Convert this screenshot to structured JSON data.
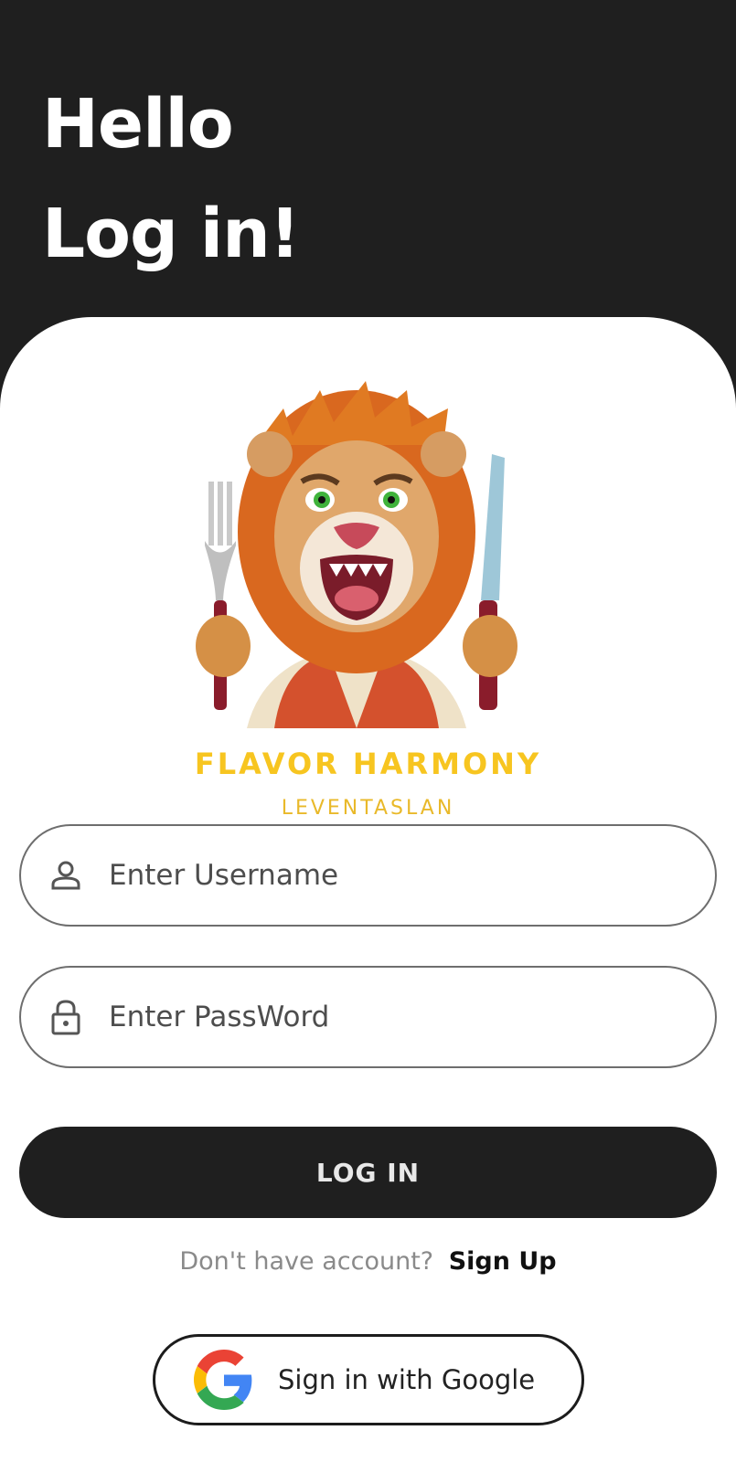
{
  "header": {
    "line1": "Hello",
    "line2": "Log in!"
  },
  "brand": {
    "title": "FLAVOR HARMONY",
    "subtitle": "LEVENTASLAN",
    "logo_icon": "lion-chef-mascot"
  },
  "form": {
    "username": {
      "placeholder": "Enter Username",
      "icon": "person-icon"
    },
    "password": {
      "placeholder": "Enter PassWord",
      "icon": "lock-icon"
    },
    "login_label": "LOG IN"
  },
  "signup": {
    "question": "Don't have account?",
    "link": "Sign Up"
  },
  "google": {
    "label": "Sign in with Google",
    "icon": "google-g-icon"
  },
  "colors": {
    "dark": "#1f1f1f",
    "brand_yellow": "#f7c520",
    "card": "#ffffff"
  }
}
